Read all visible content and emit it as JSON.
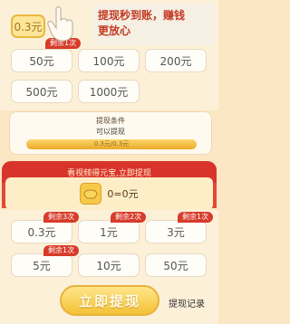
{
  "tooltip": {
    "line1": "提现秒到账，赚钱",
    "line2": "更放心"
  },
  "top_amounts": [
    {
      "label": "0.3元",
      "badge": "剩余1次",
      "selected": true
    },
    {
      "label": "50元"
    },
    {
      "label": "100元"
    },
    {
      "label": "200元"
    },
    {
      "label": "500元"
    },
    {
      "label": "1000元"
    }
  ],
  "condition": {
    "title": "提现条件",
    "subtitle": "可以提现",
    "progress_text": "0.3元/0.3元",
    "progress_fraction": 1.0
  },
  "video_section": {
    "header": "看视频得元宝,立即提现",
    "ingot_text": "0=0元"
  },
  "bottom_amounts": [
    {
      "label": "0.3元",
      "badge": "剩余3次"
    },
    {
      "label": "1元",
      "badge": "剩余2次"
    },
    {
      "label": "3元",
      "badge": "剩余1次"
    },
    {
      "label": "5元",
      "badge": "剩余1次"
    },
    {
      "label": "10元"
    },
    {
      "label": "50元"
    }
  ],
  "actions": {
    "submit": "立即提现",
    "record": "提现记录"
  },
  "colors": {
    "accent_red": "#d9342b",
    "gold": "#f4c236",
    "panel": "#fdf0d9"
  }
}
